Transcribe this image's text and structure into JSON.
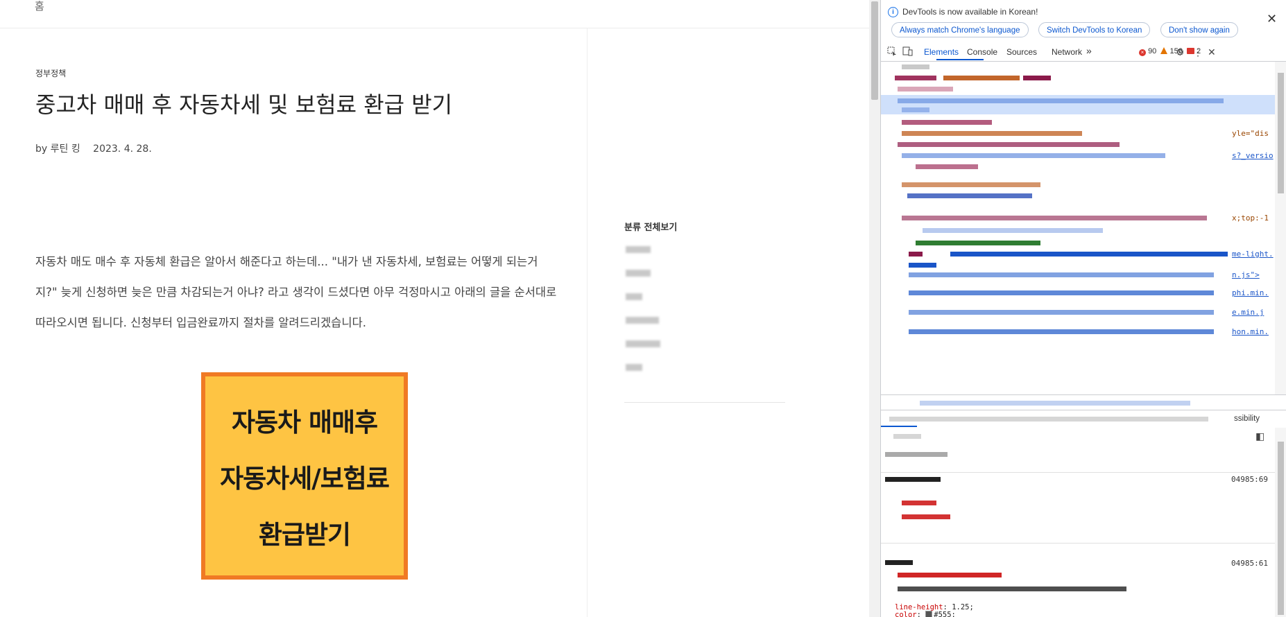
{
  "page": {
    "breadcrumb": "홈",
    "category": "정부정책",
    "title": "중고차 매매 후 자동차세 및 보험료 환급 받기",
    "byline_prefix": "by",
    "author": "루틴 킹",
    "date": "2023. 4. 28.",
    "body_lines": [
      "자동차 매도 매수 후 자동체 환급은 알아서 해준다고 하는데... \"내가 낸 자동차세, 보험료는 어떻게 되는거",
      "지?\" 늦게 신청하면 늦은 만큼 차감되는거 아냐? 라고 생각이 드셨다면 아무 걱정마시고 아래의 글을 순서대로",
      "따라오시면 됩니다. 신청부터 입금완료까지 절차를 알려드리겠습니다."
    ],
    "thumbnail_lines": [
      "자동차 매매후",
      "자동차세/보험료",
      "환급받기"
    ],
    "thumbnail_colors": {
      "fill": "#fec443",
      "border": "#f07a24"
    },
    "sidebar_title": "분류 전체보기"
  },
  "devtools": {
    "info_icon": "info-icon",
    "info_message": "DevTools is now available in Korean!",
    "info_buttons": [
      "Always match Chrome's language",
      "Switch DevTools to Korean",
      "Don't show again"
    ],
    "close_glyph": "✕",
    "tabs": [
      "Elements",
      "Console",
      "Sources",
      "Network"
    ],
    "active_tab": "Elements",
    "more_tabs_glyph": "»",
    "error_count": "90",
    "warning_count": "156",
    "issue_count": "2",
    "dom_fragments": {
      "attr1": "yle=\"dis",
      "link1": "s?_versio",
      "attr2": "x;top:-1",
      "link2": "me-light.",
      "link3": "n.js\">",
      "link4": "phi.min.",
      "link5": "e.min.j",
      "link6": "hon.min."
    },
    "accessibility_tab": "ssibility",
    "styles": {
      "src1": "04985:69",
      "src2": "04985:61",
      "lines": [
        {
          "prop": "line-height",
          "val": "1.25;"
        },
        {
          "prop": "color",
          "val": "#555;"
        }
      ]
    },
    "accent": "#0b57d0"
  }
}
